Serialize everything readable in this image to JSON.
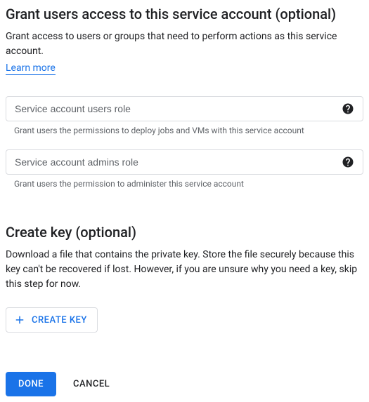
{
  "grant_section": {
    "title": "Grant users access to this service account (optional)",
    "description": "Grant access to users or groups that need to perform actions as this service account.",
    "learn_more": "Learn more",
    "users_role": {
      "placeholder": "Service account users role",
      "helper": "Grant users the permissions to deploy jobs and VMs with this service account"
    },
    "admins_role": {
      "placeholder": "Service account admins role",
      "helper": "Grant users the permission to administer this service account"
    }
  },
  "create_key_section": {
    "title": "Create key (optional)",
    "description": "Download a file that contains the private key. Store the file securely because this key can't be recovered if lost. However, if you are unsure why you need a key, skip this step for now.",
    "button_label": "CREATE KEY"
  },
  "actions": {
    "done": "DONE",
    "cancel": "CANCEL"
  }
}
